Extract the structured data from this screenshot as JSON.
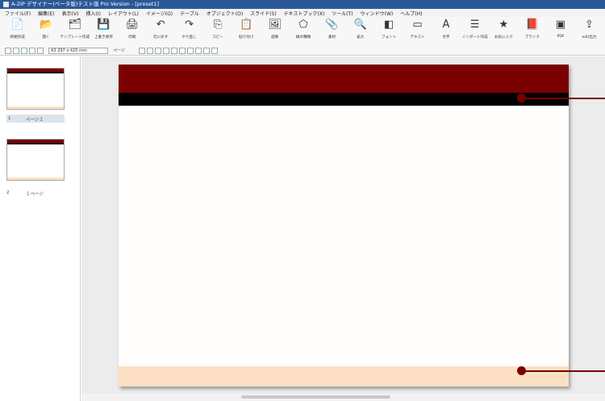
{
  "window": {
    "title": "A-ZIP デザイナー(ベータ版)テスト版 Pro Version - [preset1]"
  },
  "menu": [
    "ファイル(F)",
    "編集(E)",
    "表示(V)",
    "挿入(I)",
    "レイアウト(L)",
    "イメージ(G)",
    "テーブル",
    "オブジェクト(O)",
    "スライド(S)",
    "テキストブック(X)",
    "ツール(T)",
    "ウィンドウ(W)",
    "ヘルプ(H)"
  ],
  "ribbon": [
    {
      "icon": "new-icon",
      "glyph": "📄",
      "label": "新規作成"
    },
    {
      "icon": "open-icon",
      "glyph": "📂",
      "label": "開く"
    },
    {
      "icon": "template-icon",
      "glyph": "🗂",
      "label": "テンプレート作成"
    },
    {
      "icon": "save-icon",
      "glyph": "💾",
      "label": "上書き保存"
    },
    {
      "icon": "print-icon",
      "glyph": "🖨",
      "label": "印刷"
    },
    {
      "icon": "undo-icon",
      "glyph": "↶",
      "label": "元に戻す"
    },
    {
      "icon": "redo-icon",
      "glyph": "↷",
      "label": "やり直し"
    },
    {
      "icon": "copy-icon",
      "glyph": "⎘",
      "label": "コピー"
    },
    {
      "icon": "paste-icon",
      "glyph": "📋",
      "label": "貼り付け"
    },
    {
      "icon": "image-icon",
      "glyph": "🖼",
      "label": "画像"
    },
    {
      "icon": "shape-icon",
      "glyph": "⬠",
      "label": "線の種類"
    },
    {
      "icon": "clip-icon",
      "glyph": "📎",
      "label": "素材"
    },
    {
      "icon": "zoom-icon",
      "glyph": "🔍",
      "label": "拡大"
    },
    {
      "icon": "color-icon",
      "glyph": "◧",
      "label": "フォント"
    },
    {
      "icon": "textbox-icon",
      "glyph": "▭",
      "label": "テキスト"
    },
    {
      "icon": "text-icon",
      "glyph": "A",
      "label": "文字"
    },
    {
      "icon": "list-icon",
      "glyph": "☰",
      "label": "インポート作成"
    },
    {
      "icon": "star-icon",
      "glyph": "★",
      "label": "お気に入り"
    },
    {
      "icon": "book-icon",
      "glyph": "📕",
      "label": "ブランク"
    },
    {
      "icon": "pdf-icon",
      "glyph": "▣",
      "label": "PDF"
    },
    {
      "icon": "export-icon",
      "glyph": "⇪",
      "label": "edit出力"
    }
  ],
  "toolbar2": {
    "page_size": "A3 297 x 420 mm",
    "page_label": "ページ"
  },
  "pages": [
    {
      "label": "ページ１",
      "number": "1"
    },
    {
      "label": "１ページ",
      "number": "2"
    }
  ],
  "colors": {
    "header_red": "#7b0000",
    "header_black": "#000000",
    "footer_peach": "#fde0c4",
    "callout": "#7a0000"
  }
}
